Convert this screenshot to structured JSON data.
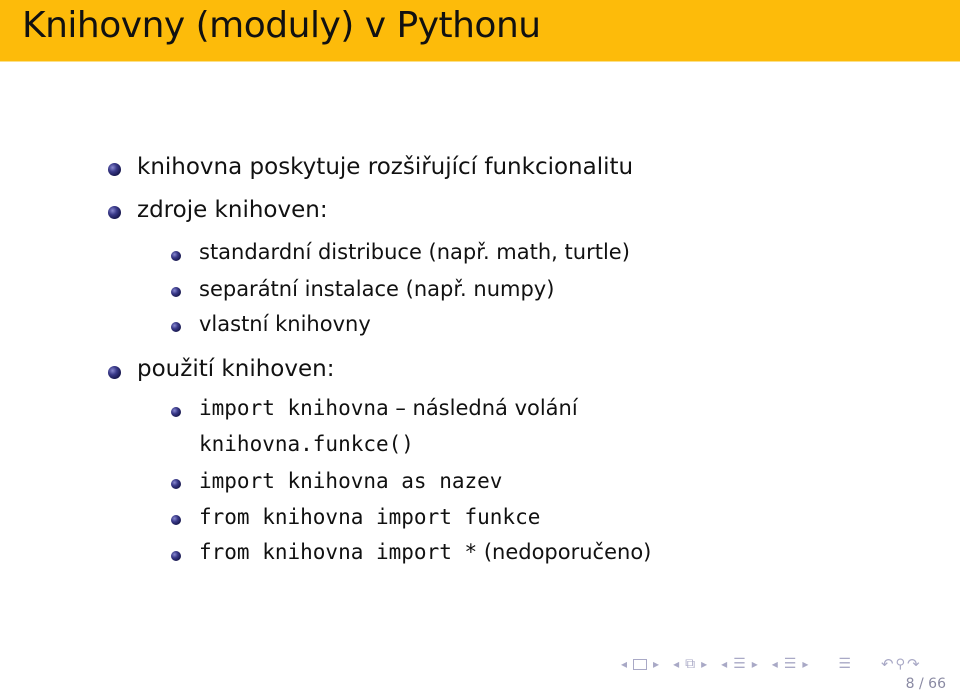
{
  "slide": {
    "title": "Knihovny (moduly) v Pythonu",
    "accent_color": "#FDBB0A",
    "items": [
      {
        "level": 1,
        "text": "knihovna poskytuje rozšiřující funkcionalitu"
      },
      {
        "level": 1,
        "text": "zdroje knihoven:"
      },
      {
        "level": 2,
        "text": "standardní distribuce (např. math, turtle)"
      },
      {
        "level": 2,
        "text": "separátní instalace (např. numpy)"
      },
      {
        "level": 2,
        "text": "vlastní knihovny"
      },
      {
        "level": 1,
        "text": "použití knihoven:"
      },
      {
        "level": 2,
        "code": "import knihovna",
        "text": " – následná volání",
        "continuation_code": "knihovna.funkce()"
      },
      {
        "level": 2,
        "code": "import knihovna as nazev"
      },
      {
        "level": 2,
        "code": "from knihovna import funkce"
      },
      {
        "level": 2,
        "code": "from knihovna import *",
        "text": " (nedoporučeno)"
      }
    ]
  },
  "navigation": {
    "icons": [
      "arrow-left-icon",
      "frame-icon",
      "arrow-right-icon",
      "arrow-left-icon",
      "frames-icon",
      "arrow-right-icon",
      "arrow-left-icon",
      "subsection-icon",
      "arrow-right-icon",
      "arrow-left-icon",
      "section-icon",
      "arrow-right-icon",
      "document-icon",
      "undo-icon",
      "search-icon",
      "redo-icon"
    ],
    "page": "8 / 66"
  }
}
